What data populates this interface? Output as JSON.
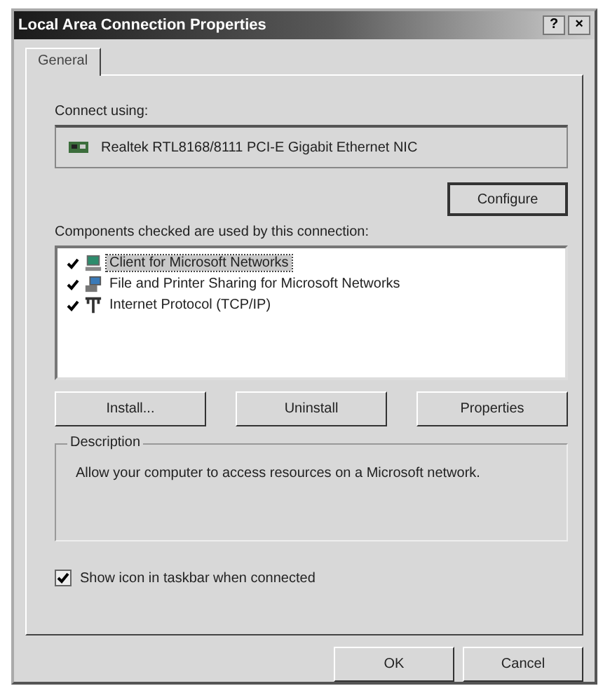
{
  "window": {
    "title": "Local Area Connection Properties",
    "help_button": "?",
    "close_button": "×"
  },
  "tabs": [
    {
      "label": "General",
      "selected": true
    }
  ],
  "connect_using": {
    "label": "Connect using:",
    "adapter": "Realtek RTL8168/8111 PCI-E Gigabit Ethernet NIC",
    "configure_button": "Configure"
  },
  "components": {
    "label": "Components checked are used by this connection:",
    "items": [
      {
        "name": "Client for Microsoft Networks",
        "checked": true,
        "selected": true,
        "kind": "client"
      },
      {
        "name": "File and Printer Sharing for Microsoft Networks",
        "checked": true,
        "selected": false,
        "kind": "service"
      },
      {
        "name": "Internet Protocol (TCP/IP)",
        "checked": true,
        "selected": false,
        "kind": "protocol"
      }
    ],
    "buttons": [
      "Install...",
      "Uninstall",
      "Properties"
    ]
  },
  "description": {
    "label": "Description",
    "text": "Allow your computer to access resources on a Microsoft network."
  },
  "taskbar_option": {
    "label": "Show icon in taskbar when connected",
    "checked": true
  },
  "buttons": [
    "OK",
    "Cancel"
  ]
}
